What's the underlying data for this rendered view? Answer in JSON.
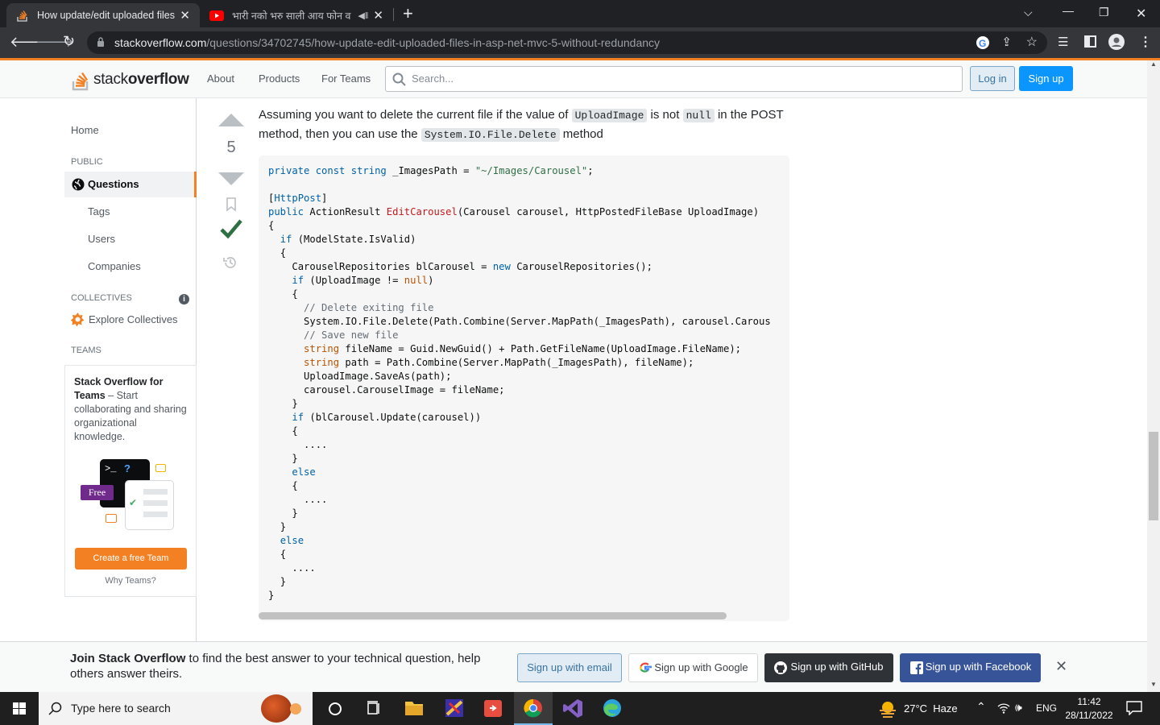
{
  "browser": {
    "tabs": [
      {
        "title": "How update/edit uploaded files i",
        "active": true
      },
      {
        "title": "भारी नको भरु साली आय फोन व",
        "active": false
      }
    ],
    "new_tab": "+",
    "url_domain": "stackoverflow.com",
    "url_path": "/questions/34702745/how-update-edit-uploaded-files-in-asp-net-mvc-5-without-redundancy"
  },
  "header": {
    "logo_text_1": "stack",
    "logo_text_2": "overflow",
    "nav": [
      "About",
      "Products",
      "For Teams"
    ],
    "search_placeholder": "Search...",
    "login": "Log in",
    "signup": "Sign up"
  },
  "sidebar": {
    "home": "Home",
    "public_heading": "PUBLIC",
    "questions": "Questions",
    "tags": "Tags",
    "users": "Users",
    "companies": "Companies",
    "collectives_heading": "COLLECTIVES",
    "explore_collectives": "Explore Collectives",
    "teams_heading": "TEAMS",
    "teams_title": "Stack Overflow for Teams",
    "teams_desc": " – Start collaborating and sharing organizational knowledge.",
    "free_badge": "Free",
    "create_team": "Create a free Team",
    "why_teams": "Why Teams?"
  },
  "post": {
    "score": "5",
    "text_1": "Assuming you want to delete the current file if the value of ",
    "code_1": "UploadImage",
    "text_2": " is not ",
    "code_2": "null",
    "text_3": " in the POST method, then you can use the ",
    "code_3": "System.IO.File.Delete",
    "text_4": " method",
    "code": {
      "l1_kw": "private const",
      "l1_ty": "string",
      "l1_rest": " _ImagesPath = ",
      "l1_str": "\"~/Images/Carousel\"",
      "l1_end": ";",
      "l3_attr": "HttpPost",
      "l4_kw": "public",
      "l4_rest1": " ActionResult ",
      "l4_fn": "EditCarousel",
      "l4_rest2": "(Carousel carousel, HttpPostedFileBase UploadImage)",
      "l5": "{",
      "l6_kw": "if",
      "l6_rest": " (ModelState.IsValid)",
      "l7": "{",
      "l8_a": "CarouselRepositories blCarousel = ",
      "l8_kw": "new",
      "l8_b": " CarouselRepositories();",
      "l9_kw": "if",
      "l9_a": " (UploadImage != ",
      "l9_null": "null",
      "l9_b": ")",
      "l10": "{",
      "l11_cm": "// Delete exiting file",
      "l12": "System.IO.File.Delete(Path.Combine(Server.MapPath(_ImagesPath), carousel.Carous",
      "l13_cm": "// Save new file",
      "l14_ty": "string",
      "l14_rest": " fileName = Guid.NewGuid() + Path.GetFileName(UploadImage.FileName);",
      "l15_ty": "string",
      "l15_rest": " path = Path.Combine(Server.MapPath(_ImagesPath), fileName);",
      "l16": "UploadImage.SaveAs(path);",
      "l17": "carousel.CarouselImage = fileName;",
      "l18": "}",
      "l19_kw": "if",
      "l19_rest": " (blCarousel.Update(carousel))",
      "l20": "{",
      "l21": "....",
      "l22": "}",
      "l23_kw": "else",
      "l24": "{",
      "l25": "....",
      "l26": "}",
      "l27": "}",
      "l28_kw": "else",
      "l29": "{",
      "l30": "....",
      "l31": "}",
      "l32": "}"
    }
  },
  "banner": {
    "bold": "Join Stack Overflow",
    "text": " to find the best answer to your technical question, help others answer theirs.",
    "email": "Sign up with email",
    "google": "Sign up with Google",
    "github": "Sign up with GitHub",
    "facebook": "Sign up with Facebook"
  },
  "taskbar": {
    "search_placeholder": "Type here to search",
    "weather": "27°C  Haze",
    "lang": "ENG",
    "time": "11:42",
    "date": "28/11/2022"
  },
  "colors": {
    "so_orange": "#f48024",
    "so_blue": "#0a95ff",
    "accepted_green": "#2f6f44",
    "github_black": "#2f3337",
    "facebook_blue": "#385499"
  }
}
